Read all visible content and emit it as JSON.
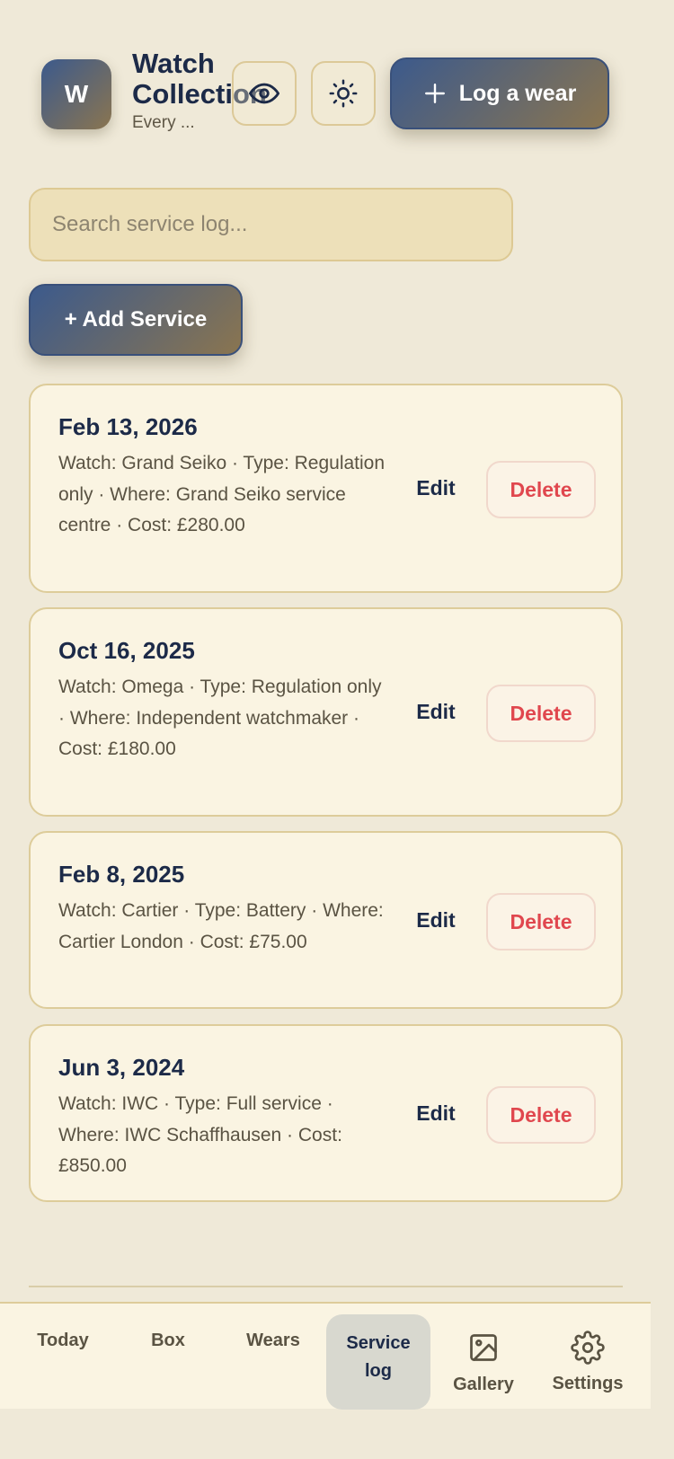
{
  "header": {
    "logo_letter": "W",
    "title": "Watch\nCollection",
    "subtitle": "Every ...",
    "eye_icon": "eye-icon",
    "theme_icon": "sun-icon",
    "log_wear_label": "Log a wear"
  },
  "search": {
    "placeholder": "Search service log..."
  },
  "actions": {
    "add_service_label": "+ Add Service"
  },
  "entries": [
    {
      "date": "Feb 13, 2026",
      "desc": "Watch: Grand Seiko · Type: Regulation only · Where: Grand Seiko service centre · Cost: £280.00",
      "edit": "Edit",
      "delete": "Delete"
    },
    {
      "date": "Oct 16, 2025",
      "desc": "Watch: Omega · Type: Regulation only · Where: Independent watchmaker · Cost: £180.00",
      "edit": "Edit",
      "delete": "Delete"
    },
    {
      "date": "Feb 8, 2025",
      "desc": "Watch: Cartier · Type: Battery · Where: Cartier London · Cost: £75.00",
      "edit": "Edit",
      "delete": "Delete"
    },
    {
      "date": "Jun 3, 2024",
      "desc": "Watch: IWC · Type: Full service · Where: IWC Schaffhausen · Cost: £850.00",
      "edit": "Edit",
      "delete": "Delete"
    }
  ],
  "nav": {
    "today": "Today",
    "box": "Box",
    "wears": "Wears",
    "service_log": "Service log",
    "gallery": "Gallery",
    "gallery_icon": "image-icon",
    "settings": "Settings",
    "settings_icon": "gear-icon",
    "active": "Service log"
  },
  "colors": {
    "background": "#efe9d8",
    "card": "#faf4e2",
    "accent_start": "#3c5a8c",
    "accent_end": "#8a7550",
    "danger": "#e0474e",
    "text": "#1c2a48"
  }
}
